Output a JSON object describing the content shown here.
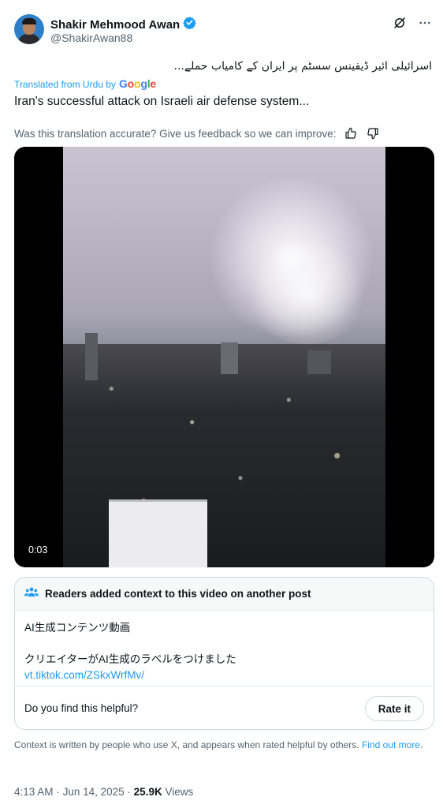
{
  "author": {
    "display_name": "Shakir Mehmood Awan",
    "handle": "@ShakirAwan88"
  },
  "post": {
    "original_text": "اسرائیلی ائیر ڈیفینس سسٹم پر ایران کے کامیاب حملے...",
    "translated_from": "Translated from Urdu by",
    "google_label": "Google",
    "translation": "Iran's successful attack on Israeli air defense system...",
    "feedback_prompt": "Was this translation accurate? Give us feedback so we can improve:"
  },
  "video": {
    "timestamp": "0:03"
  },
  "community_note": {
    "title": "Readers added context to this video on another post",
    "line1": "AI生成コンテンツ動画",
    "line2": "クリエイターがAI生成のラベルをつけました",
    "link": "vt.tiktok.com/ZSkxWrfMv/",
    "helpful_prompt": "Do you find this helpful?",
    "rate_button": "Rate it"
  },
  "disclaimer": {
    "text": "Context is written by people who use X, and appears when rated helpful by others.",
    "link": "Find out more",
    "end": "."
  },
  "meta": {
    "time": "4:13 AM",
    "separator": "·",
    "date": "Jun 14, 2025",
    "views_count": "25.9K",
    "views_label": "Views"
  },
  "icons": {
    "verified": "verified-badge-icon",
    "grok": "grok-icon",
    "more": "more-icon",
    "thumb_up": "thumbs-up-icon",
    "thumb_down": "thumbs-down-icon",
    "community": "community-notes-icon"
  },
  "colors": {
    "accent": "#1d9bf0",
    "text": "#0f1419",
    "secondary": "#536471"
  }
}
